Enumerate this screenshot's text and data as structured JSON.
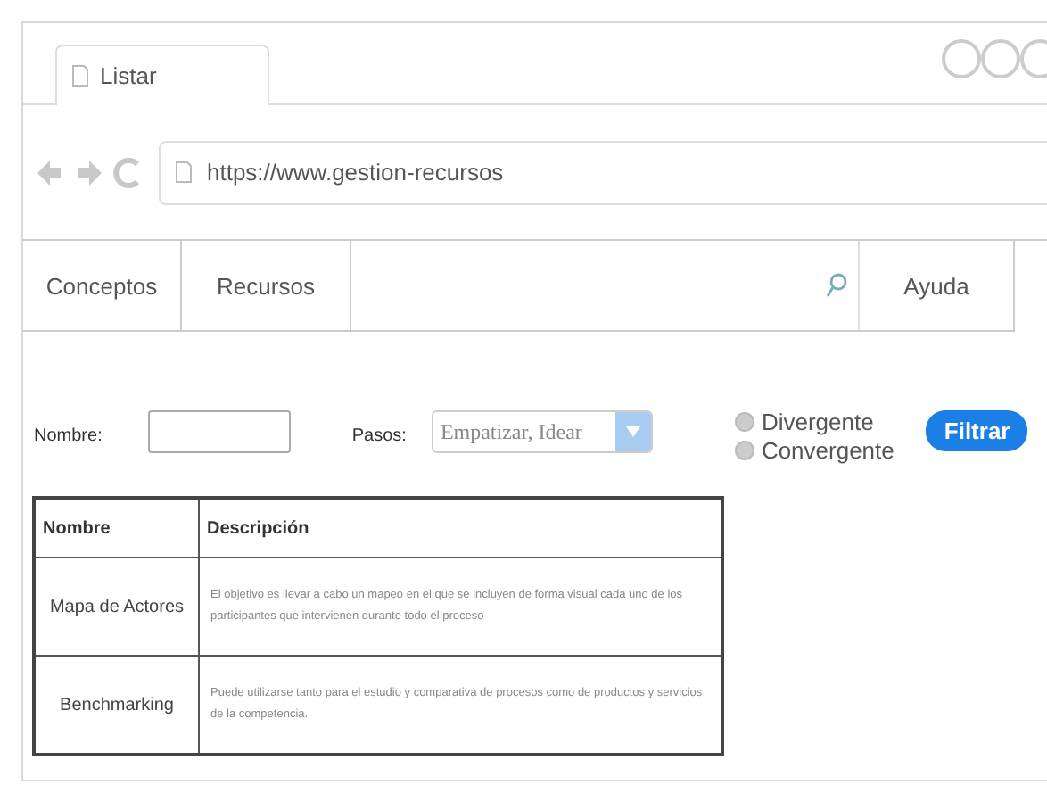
{
  "browser": {
    "tab": "Listar",
    "url": "https://www.gestion-recursos"
  },
  "nav": {
    "items": [
      "Conceptos",
      "Recursos"
    ],
    "help": "Ayuda"
  },
  "filters": {
    "name_label": "Nombre:",
    "steps_label": "Pasos:",
    "steps_value": "Empatizar, Idear",
    "options": [
      {
        "label": "Divergente",
        "selected": false
      },
      {
        "label": "Convergente",
        "selected": false
      }
    ],
    "button": "Filtrar"
  },
  "table": {
    "columns": [
      "Nombre",
      "Descripción"
    ],
    "rows": [
      {
        "name": "Mapa de Actores",
        "description": "El objetivo es llevar a cabo un mapeo en el que se incluyen de forma visual cada uno de los participantes que intervienen durante todo el proceso"
      },
      {
        "name": "Benchmarking",
        "description": "Puede utilizarse tanto para el estudio y comparativa de procesos como de productos y servicios de la competencia."
      }
    ]
  }
}
